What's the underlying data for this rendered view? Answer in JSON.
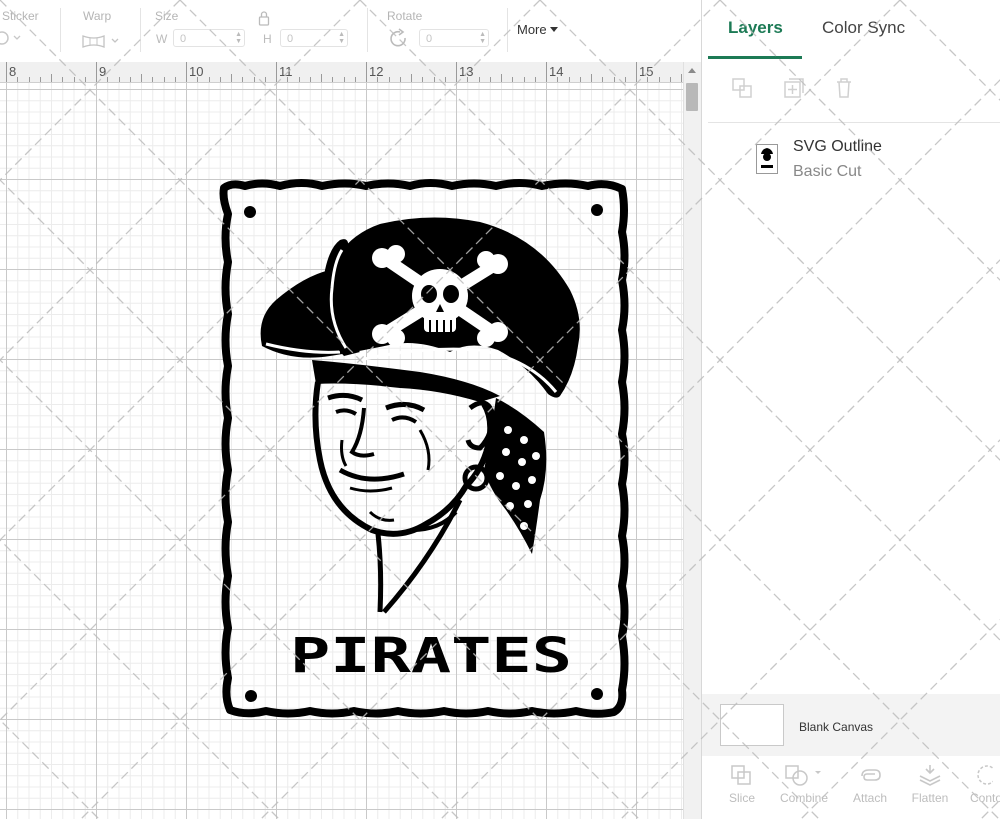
{
  "toolbar": {
    "sticker_label": "Sticker",
    "warp_label": "Warp",
    "size_label": "Size",
    "width_letter": "W",
    "width_value": "0",
    "height_letter": "H",
    "height_value": "0",
    "rotate_label": "Rotate",
    "rotate_value": "0",
    "more_label": "More"
  },
  "ruler": {
    "numbers": [
      "8",
      "9",
      "10",
      "11",
      "12",
      "13",
      "14",
      "15"
    ]
  },
  "artwork": {
    "word": "PIRATES"
  },
  "panel": {
    "tabs": {
      "layers": "Layers",
      "color_sync": "Color Sync"
    },
    "layer": {
      "name": "SVG Outline",
      "operation": "Basic Cut"
    },
    "blank_canvas_label": "Blank Canvas",
    "tools": {
      "slice": "Slice",
      "combine": "Combine",
      "attach": "Attach",
      "flatten": "Flatten",
      "contour": "Conto"
    }
  },
  "colors": {
    "accent": "#1c7a55",
    "artwork": "#000000"
  }
}
